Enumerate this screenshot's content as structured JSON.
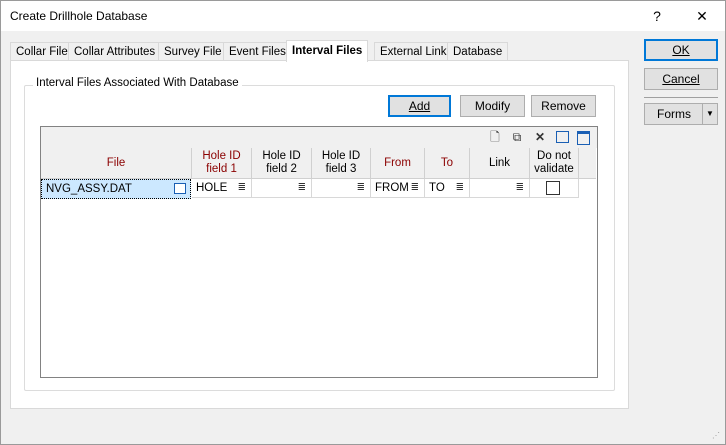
{
  "window": {
    "title": "Create Drillhole Database",
    "help_label": "?",
    "close_label": "✕"
  },
  "tabs": [
    {
      "label": "Collar File"
    },
    {
      "label": "Collar Attributes"
    },
    {
      "label": "Survey File"
    },
    {
      "label": "Event Files"
    },
    {
      "label": "Interval Files",
      "active": true
    },
    {
      "label": "External Link"
    },
    {
      "label": "Database"
    }
  ],
  "group": {
    "label": "Interval Files Associated With Database",
    "add_label": "Add",
    "modify_label": "Modify",
    "remove_label": "Remove"
  },
  "grid": {
    "toolbar_icons": [
      "new-row-icon",
      "insert-row-icon",
      "delete-row-icon",
      "window-icon",
      "window-split-icon"
    ],
    "columns": [
      {
        "label": "File"
      },
      {
        "label": "Hole ID field 1"
      },
      {
        "label": "Hole ID field 2"
      },
      {
        "label": "Hole ID field 3"
      },
      {
        "label": "From"
      },
      {
        "label": "To"
      },
      {
        "label": "Link"
      },
      {
        "label": "Do not validate"
      }
    ],
    "rows": [
      {
        "file": "NVG_ASSY.DAT",
        "hole1": "HOLE",
        "hole2": "",
        "hole3": "",
        "from": "FROM",
        "to": "TO",
        "link": "",
        "do_not_validate": false
      }
    ],
    "pick_glyph": "≣"
  },
  "side": {
    "ok_label": "OK",
    "cancel_label": "Cancel",
    "forms_label": "Forms",
    "forms_arrow": "▼"
  },
  "colors": {
    "accent": "#0078d7",
    "required_header": "#8b0000",
    "selection": "#cce8ff"
  }
}
